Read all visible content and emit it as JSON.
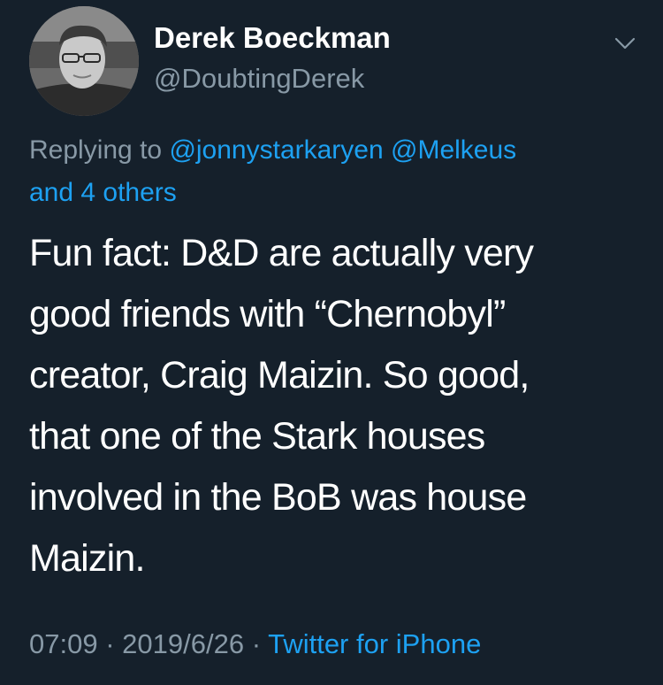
{
  "user": {
    "display_name": "Derek Boeckman",
    "handle": "@DoubtingDerek"
  },
  "reply_context": {
    "prefix": "Replying to",
    "mentions": [
      "@jonnystarkaryen",
      "@Melkeus"
    ],
    "others": "and 4 others"
  },
  "tweet": {
    "lines": [
      "Fun fact: D&D are actually very",
      "good friends with “Chernobyl”",
      "creator, Craig Maizin. So good,",
      "that one of the Stark houses",
      "involved in the BoB was house",
      "Maizin."
    ]
  },
  "meta": {
    "time": "07:09",
    "separator": "·",
    "date": "2019/6/26",
    "source": "Twitter for iPhone"
  },
  "icons": {
    "menu": "chevron-down-icon",
    "avatar": "profile-photo"
  },
  "colors": {
    "background": "#15202b",
    "text": "#ffffff",
    "secondary": "#8899a6",
    "link": "#1da1f2"
  }
}
